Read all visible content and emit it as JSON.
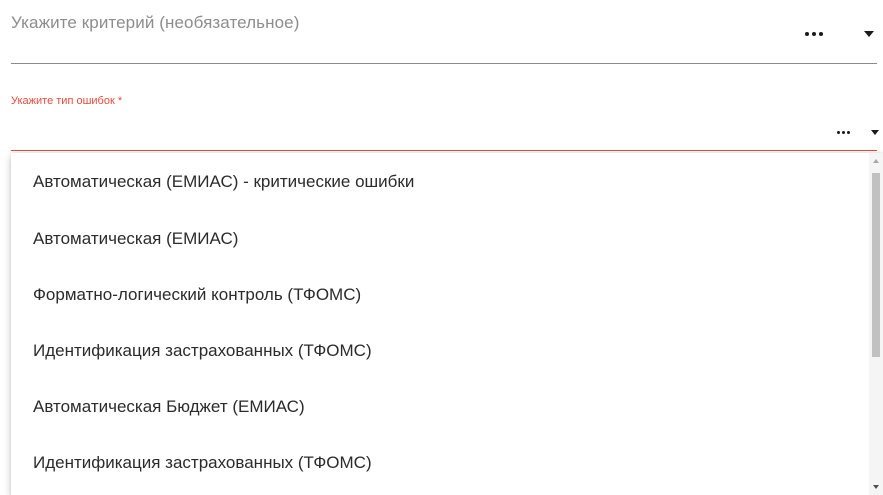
{
  "criterion_field": {
    "placeholder": "Укажите критерий (необязательное)",
    "more_icon": "more-horiz-icon",
    "dropdown_icon": "arrow-drop-down-icon"
  },
  "error_type_field": {
    "label": "Укажите тип ошибок *",
    "value": "",
    "more_icon": "more-horiz-icon",
    "dropdown_icon": "arrow-drop-down-icon",
    "state": "focused-error"
  },
  "dropdown": {
    "options": [
      "Автоматическая (ЕМИАС) - критические ошибки",
      "Автоматическая (ЕМИАС)",
      "Форматно-логический контроль (ТФОМС)",
      "Идентификация застрахованных (ТФОМС)",
      "Автоматическая Бюджет (ЕМИАС)",
      "Идентификация застрахованных (ТФОМС)"
    ]
  },
  "colors": {
    "accent_error": "#e84a3c",
    "text_primary": "#2b2b2b",
    "text_placeholder": "#8d8d8d",
    "divider": "#8a8a8a"
  }
}
